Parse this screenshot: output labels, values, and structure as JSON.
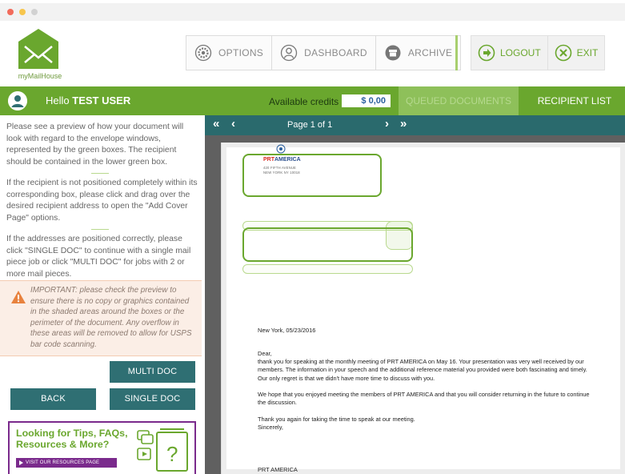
{
  "app": {
    "logo_text": "myMailHouse"
  },
  "nav": [
    {
      "label": "OPTIONS",
      "icon": "gear-icon"
    },
    {
      "label": "DASHBOARD",
      "icon": "user-icon"
    },
    {
      "label": "ARCHIVE",
      "icon": "archive-box-icon"
    }
  ],
  "actions": {
    "logout": "LOGOUT",
    "exit": "EXIT"
  },
  "user_bar": {
    "hello": "Hello",
    "user_name": "TEST USER",
    "credits_label": "Available credits",
    "credits_value": "$ 0,00",
    "queued_documents": "QUEUED DOCUMENTS",
    "recipient_list": "RECIPIENT LIST"
  },
  "instructions": {
    "p1": "Please see a preview of how your document will look with regard to the envelope windows, represented by the green boxes. The recipient should be contained in the lower green box.",
    "p2": "If the recipient is not positioned completely within its corresponding box, please click and drag over the desired recipient address to open the \"Add Cover Page\" options.",
    "p3": "If the addresses are positioned correctly, please click \"SINGLE DOC\" to continue with a single mail piece job or click \"MULTI DOC\" for jobs with 2 or more mail pieces.",
    "important": "IMPORTANT: please check the preview to ensure there is no copy or graphics contained in the shaded areas around the boxes or the perimeter of the document. Any overflow in these areas will be removed to allow for USPS bar code scanning."
  },
  "buttons": {
    "multi_doc": "MULTI DOC",
    "back": "BACK",
    "single_doc": "SINGLE DOC"
  },
  "promo": {
    "title": "Looking for Tips, FAQs, Resources & More?",
    "link": "VISIT OUR RESOURCES PAGE"
  },
  "pager": {
    "first": "«",
    "prev": "‹",
    "text": "Page 1 of 1",
    "next": "›",
    "last": "»"
  },
  "document": {
    "sender_brand_prefix": "PRT",
    "sender_brand_suffix": "AMERICA",
    "sender_line1": "420 FIFTH AVENUE",
    "sender_line2": "NEW YORK NY 10018",
    "date_line": "New York, 05/23/2016",
    "salutation": "Dear,",
    "body1": "thank you for speaking at the monthly meeting of PRT AMERICA on May 16. Your presentation was very well received by our members. The information in your speech and the additional reference material you provided were both fascinating and timely. Our only regret is that we didn't have more time to discuss with you.",
    "body2": "We hope that you enjoyed meeting the members of PRT AMERICA and that you will consider returning in the future to continue the discussion.",
    "body3": "Thank you again for taking the time to speak at our meeting.",
    "closing": "Sincerely,",
    "signature": "PRT AMERICA"
  },
  "colors": {
    "brand_green": "#6aa72e",
    "teal": "#2f6f73",
    "purple": "#7a2a8c",
    "accent_blue": "#2a5f9e"
  }
}
